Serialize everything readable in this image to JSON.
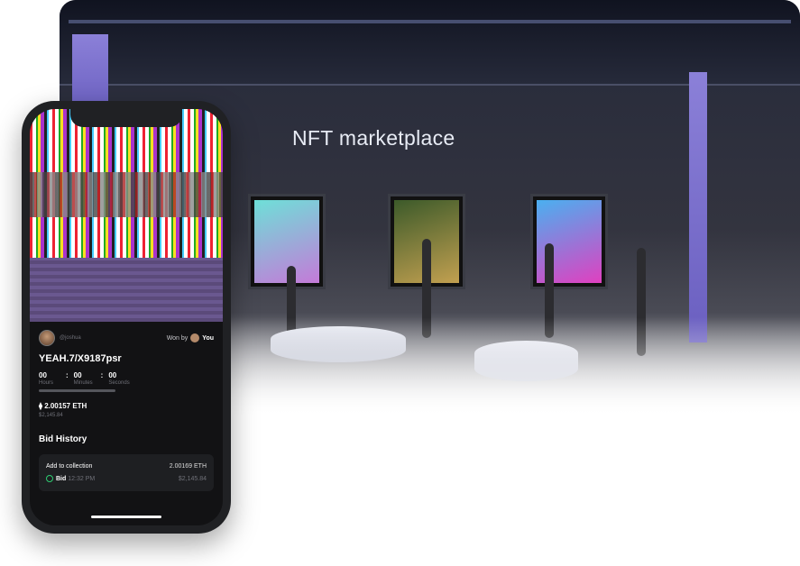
{
  "hero": {
    "title": "NFT marketplace"
  },
  "phone": {
    "owner_handle": "@joshua",
    "won_by_label": "Won by",
    "winner": "You",
    "nft_name": "YEAH.7/X9187psr",
    "timer": [
      {
        "value": "00",
        "label": "Hours"
      },
      {
        "value": "00",
        "label": "Minutes"
      },
      {
        "value": "00",
        "label": "Seconds"
      }
    ],
    "timer_progress": 0,
    "price_eth": "2.00157 ETH",
    "price_usd": "$2,145.84",
    "bid_history_title": "Bid History",
    "bids": [
      {
        "title": "Add to collection",
        "amount_eth": "2.00169 ETH",
        "status": "Bid",
        "time": "12:32 PM",
        "amount_usd": "$2,145.84"
      }
    ]
  },
  "colors": {
    "accent_green": "#2ecc71",
    "window_purple": "#8b80d8"
  }
}
